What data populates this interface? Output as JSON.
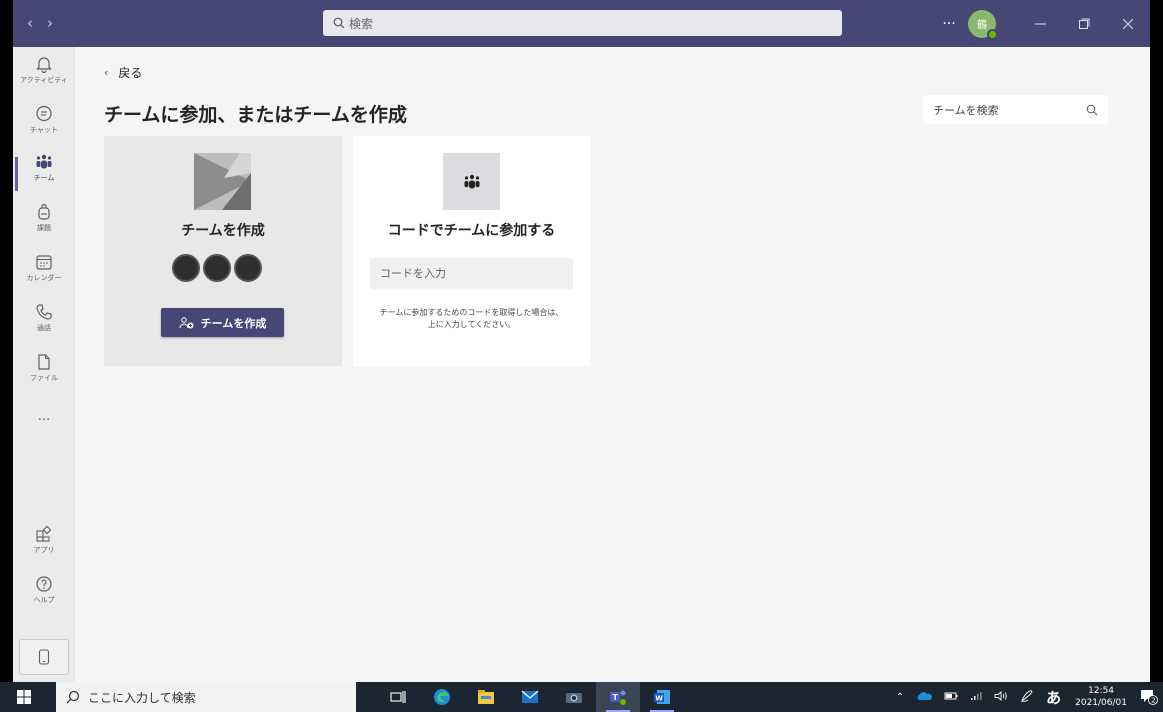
{
  "titlebar": {
    "search_placeholder": "検索",
    "more": "···",
    "avatar_initials": "鶴"
  },
  "rail": {
    "items": [
      {
        "label": "アクティビティ",
        "icon": "bell-icon"
      },
      {
        "label": "チャット",
        "icon": "chat-icon"
      },
      {
        "label": "チーム",
        "icon": "teams-icon"
      },
      {
        "label": "課題",
        "icon": "backpack-icon"
      },
      {
        "label": "カレンダー",
        "icon": "calendar-icon"
      },
      {
        "label": "通話",
        "icon": "phone-icon"
      },
      {
        "label": "ファイル",
        "icon": "file-icon"
      }
    ],
    "more": "···",
    "apps_label": "アプリ",
    "help_label": "ヘルプ"
  },
  "main": {
    "back_label": "戻る",
    "title": "チームに参加、またはチームを作成",
    "team_search_placeholder": "チームを検索",
    "create_card": {
      "title": "チームを作成",
      "button": "チームを作成"
    },
    "join_card": {
      "title": "コードでチームに参加する",
      "input_placeholder": "コードを入力",
      "hint_line1": "チームに参加するためのコードを取得した場合は、",
      "hint_line2": "上に入力してください。"
    }
  },
  "taskbar": {
    "search_placeholder": "ここに入力して検索",
    "ime": "あ",
    "time": "12:54",
    "date": "2021/06/01",
    "notification_count": "2"
  },
  "colors": {
    "brand": "#464775",
    "accent": "#6264a7"
  }
}
